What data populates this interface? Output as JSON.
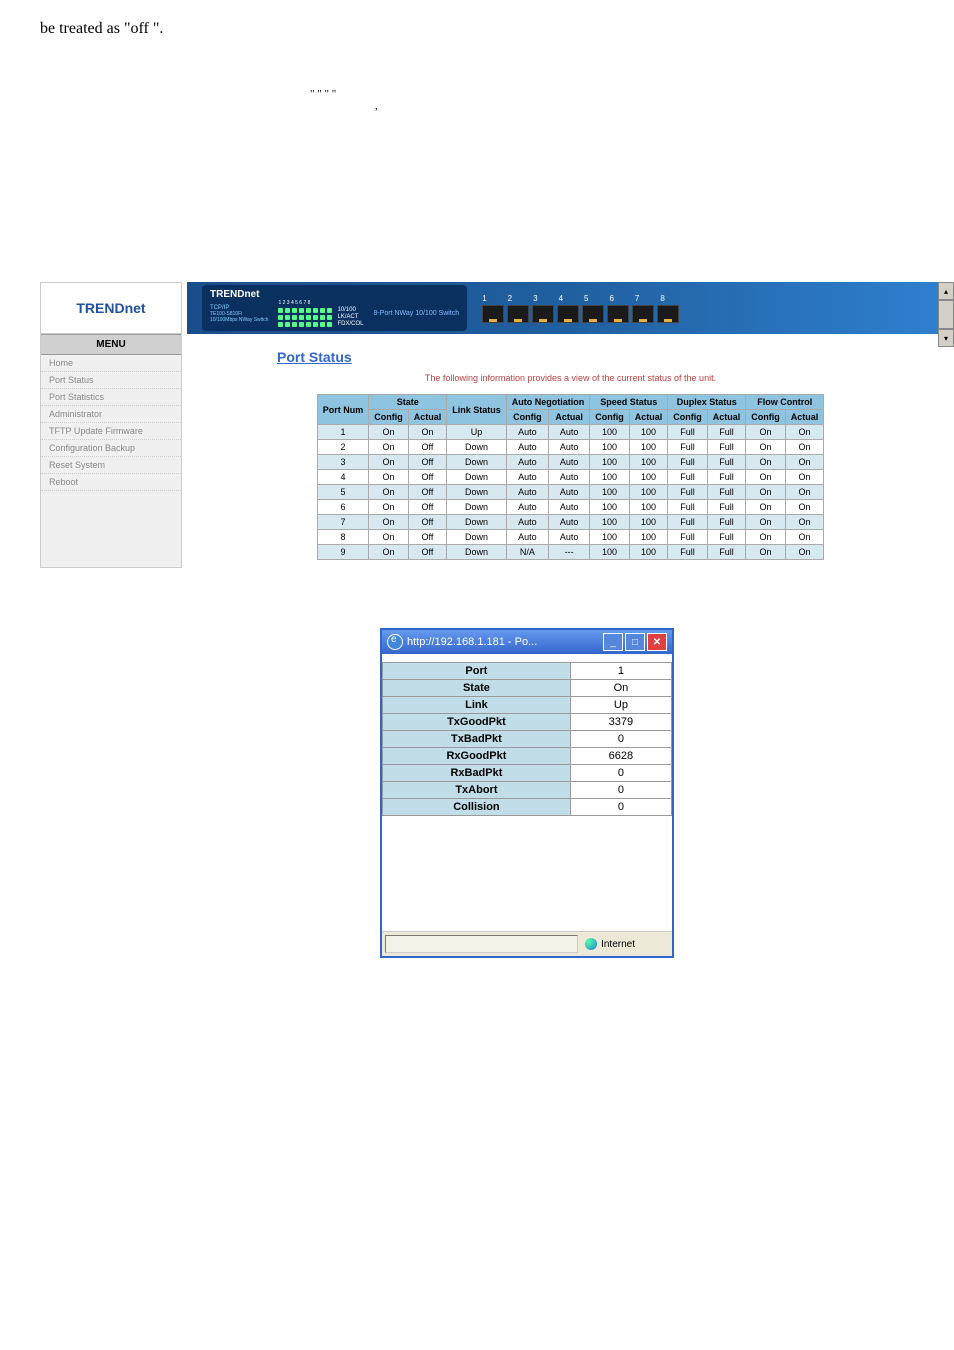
{
  "top_text": "be treated as \"off \".",
  "quotes": "\"            \"            \"        \"",
  "quotes_sub": ",",
  "sidebar": {
    "brand": "TRENDnet",
    "menu_label": "MENU",
    "items": [
      {
        "label": "Home"
      },
      {
        "label": "Port Status"
      },
      {
        "label": "Port Statistics"
      },
      {
        "label": "Administrator"
      },
      {
        "label": "TFTP Update Firmware"
      },
      {
        "label": "Configuration Backup"
      },
      {
        "label": "Reset System"
      },
      {
        "label": "Reboot"
      }
    ]
  },
  "banner": {
    "brand": "TRENDnet",
    "tcpip": "TCP/IP",
    "model_line1": "TE100-S810Fi",
    "model_line2": "10/100Mbps NWay Switch",
    "led_labels": {
      "nums": "1 2 3 4 5 6 7 8",
      "row1": "10/100",
      "row2": "LK/ACT",
      "row3": "FDX/COL"
    },
    "product": "8-Port  NWay 10/100 Switch",
    "port_nums": [
      "1",
      "2",
      "3",
      "4",
      "5",
      "6",
      "7",
      "8"
    ]
  },
  "page": {
    "heading": "Port Status",
    "subtitle": "The following information provides a view of the current status of the unit."
  },
  "table": {
    "headers": {
      "port": "Port Num",
      "state": "State",
      "link": "Link Status",
      "autoneg": "Auto Negotiation",
      "speed": "Speed Status",
      "duplex": "Duplex Status",
      "flow": "Flow Control",
      "config": "Config",
      "actual": "Actual"
    },
    "rows": [
      {
        "port": "1",
        "stc": "On",
        "sta": "On",
        "link": "Up",
        "anc": "Auto",
        "ana": "Auto",
        "spc": "100",
        "spa": "100",
        "dc": "Full",
        "da": "Full",
        "fc": "On",
        "fa": "On"
      },
      {
        "port": "2",
        "stc": "On",
        "sta": "Off",
        "link": "Down",
        "anc": "Auto",
        "ana": "Auto",
        "spc": "100",
        "spa": "100",
        "dc": "Full",
        "da": "Full",
        "fc": "On",
        "fa": "On"
      },
      {
        "port": "3",
        "stc": "On",
        "sta": "Off",
        "link": "Down",
        "anc": "Auto",
        "ana": "Auto",
        "spc": "100",
        "spa": "100",
        "dc": "Full",
        "da": "Full",
        "fc": "On",
        "fa": "On"
      },
      {
        "port": "4",
        "stc": "On",
        "sta": "Off",
        "link": "Down",
        "anc": "Auto",
        "ana": "Auto",
        "spc": "100",
        "spa": "100",
        "dc": "Full",
        "da": "Full",
        "fc": "On",
        "fa": "On"
      },
      {
        "port": "5",
        "stc": "On",
        "sta": "Off",
        "link": "Down",
        "anc": "Auto",
        "ana": "Auto",
        "spc": "100",
        "spa": "100",
        "dc": "Full",
        "da": "Full",
        "fc": "On",
        "fa": "On"
      },
      {
        "port": "6",
        "stc": "On",
        "sta": "Off",
        "link": "Down",
        "anc": "Auto",
        "ana": "Auto",
        "spc": "100",
        "spa": "100",
        "dc": "Full",
        "da": "Full",
        "fc": "On",
        "fa": "On"
      },
      {
        "port": "7",
        "stc": "On",
        "sta": "Off",
        "link": "Down",
        "anc": "Auto",
        "ana": "Auto",
        "spc": "100",
        "spa": "100",
        "dc": "Full",
        "da": "Full",
        "fc": "On",
        "fa": "On"
      },
      {
        "port": "8",
        "stc": "On",
        "sta": "Off",
        "link": "Down",
        "anc": "Auto",
        "ana": "Auto",
        "spc": "100",
        "spa": "100",
        "dc": "Full",
        "da": "Full",
        "fc": "On",
        "fa": "On"
      },
      {
        "port": "9",
        "stc": "On",
        "sta": "Off",
        "link": "Down",
        "anc": "N/A",
        "ana": "---",
        "spc": "100",
        "spa": "100",
        "dc": "Full",
        "da": "Full",
        "fc": "On",
        "fa": "On"
      }
    ]
  },
  "dialog": {
    "title": "http://192.168.1.181 - Po...",
    "stats": [
      {
        "label": "Port",
        "value": "1"
      },
      {
        "label": "State",
        "value": "On"
      },
      {
        "label": "Link",
        "value": "Up"
      },
      {
        "label": "TxGoodPkt",
        "value": "3379"
      },
      {
        "label": "TxBadPkt",
        "value": "0"
      },
      {
        "label": "RxGoodPkt",
        "value": "6628"
      },
      {
        "label": "RxBadPkt",
        "value": "0"
      },
      {
        "label": "TxAbort",
        "value": "0"
      },
      {
        "label": "Collision",
        "value": "0"
      }
    ],
    "status": "Internet"
  }
}
